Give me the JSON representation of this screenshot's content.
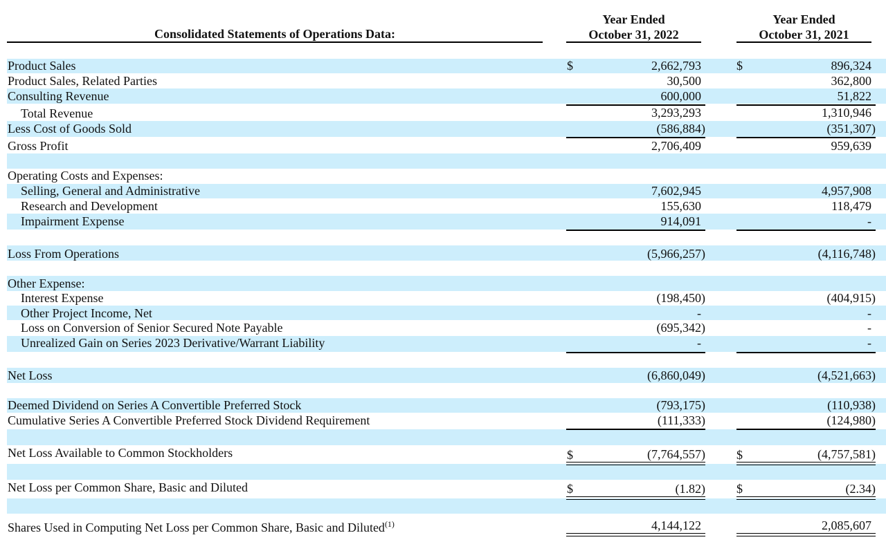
{
  "header": {
    "title": "Consolidated Statements of Operations Data:",
    "col1_line1": "Year Ended",
    "col1_line2": "October 31, 2022",
    "col2_line1": "Year Ended",
    "col2_line2": "October 31, 2021"
  },
  "currency_symbol": "$",
  "rows": {
    "product_sales": {
      "label": "Product Sales",
      "v2022": "2,662,793",
      "v2021": "896,324"
    },
    "product_sales_rp": {
      "label": "Product Sales, Related Parties",
      "v2022": "30,500",
      "v2021": "362,800"
    },
    "consulting_revenue": {
      "label": "Consulting Revenue",
      "v2022": "600,000",
      "v2021": "51,822"
    },
    "total_revenue": {
      "label": "Total Revenue",
      "v2022": "3,293,293",
      "v2021": "1,310,946"
    },
    "cogs": {
      "label": "Less Cost of Goods Sold",
      "v2022": "(586,884)",
      "v2021": "(351,307)"
    },
    "gross_profit": {
      "label": "Gross Profit",
      "v2022": "2,706,409",
      "v2021": "959,639"
    },
    "opex_header": {
      "label": "Operating Costs and Expenses:"
    },
    "sga": {
      "label": "Selling, General and Administrative",
      "v2022": "7,602,945",
      "v2021": "4,957,908"
    },
    "rnd": {
      "label": "Research and Development",
      "v2022": "155,630",
      "v2021": "118,479"
    },
    "impairment": {
      "label": "Impairment Expense",
      "v2022": "914,091",
      "v2021": "-"
    },
    "loss_ops": {
      "label": "Loss From Operations",
      "v2022": "(5,966,257)",
      "v2021": "(4,116,748)"
    },
    "other_header": {
      "label": "Other Expense:"
    },
    "interest": {
      "label": "Interest Expense",
      "v2022": "(198,450)",
      "v2021": "(404,915)"
    },
    "other_project": {
      "label": "Other Project Income, Net",
      "v2022": "-",
      "v2021": "-"
    },
    "loss_conversion": {
      "label": "Loss on Conversion of Senior Secured Note Payable",
      "v2022": "(695,342)",
      "v2021": "-"
    },
    "unrealized_gain": {
      "label": "Unrealized Gain on Series 2023 Derivative/Warrant Liability",
      "v2022": "-",
      "v2021": "-"
    },
    "net_loss": {
      "label": "Net Loss",
      "v2022": "(6,860,049)",
      "v2021": "(4,521,663)"
    },
    "deemed_dividend": {
      "label": "Deemed Dividend on Series A Convertible Preferred Stock",
      "v2022": "(793,175)",
      "v2021": "(110,938)"
    },
    "cumulative_dividend": {
      "label": "Cumulative Series A Convertible Preferred Stock Dividend Requirement",
      "v2022": "(111,333)",
      "v2021": "(124,980)"
    },
    "net_loss_common": {
      "label": "Net Loss Available to Common Stockholders",
      "v2022": "(7,764,557)",
      "v2021": "(4,757,581)"
    },
    "net_loss_per_share": {
      "label": "Net Loss per Common Share, Basic and Diluted",
      "v2022": "(1.82)",
      "v2021": "(2.34)"
    },
    "shares_used": {
      "label": "Shares Used in Computing Net Loss per Common Share, Basic and Diluted",
      "footnote": "(1)",
      "v2022": "4,144,122",
      "v2021": "2,085,607"
    }
  }
}
